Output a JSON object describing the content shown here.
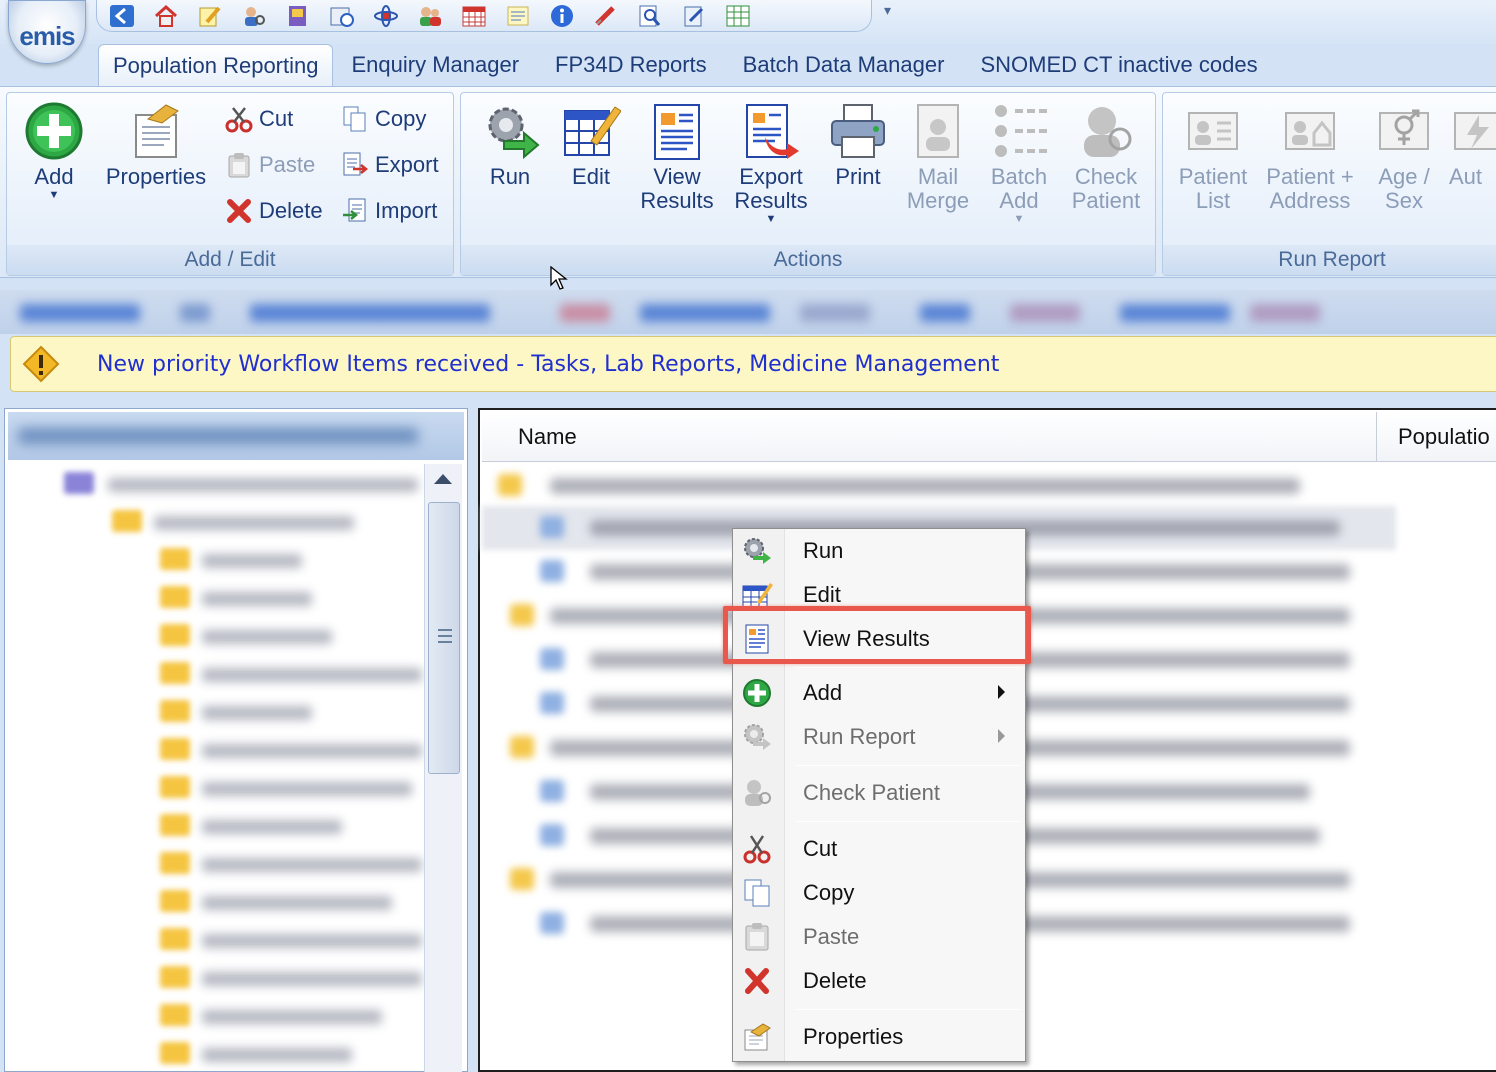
{
  "app": {
    "logo_text": "emis"
  },
  "tabs": [
    {
      "label": "Population Reporting",
      "active": true
    },
    {
      "label": "Enquiry Manager",
      "active": false
    },
    {
      "label": "FP34D Reports",
      "active": false
    },
    {
      "label": "Batch Data Manager",
      "active": false
    },
    {
      "label": "SNOMED CT inactive codes",
      "active": false
    }
  ],
  "ribbon": {
    "add_edit": {
      "label": "Add / Edit",
      "add": "Add",
      "properties": "Properties",
      "cut": "Cut",
      "paste": "Paste",
      "delete": "Delete",
      "copy": "Copy",
      "export": "Export",
      "import": "Import"
    },
    "actions": {
      "label": "Actions",
      "run": "Run",
      "edit": "Edit",
      "view_results": "View\nResults",
      "export_results": "Export\nResults",
      "print": "Print",
      "mail_merge": "Mail\nMerge",
      "batch_add": "Batch\nAdd",
      "check_patient": "Check\nPatient"
    },
    "run_report": {
      "label": "Run Report",
      "patient_list": "Patient\nList",
      "patient_address": "Patient +\nAddress",
      "age_sex": "Age /\nSex",
      "auto": "Aut"
    }
  },
  "notification": {
    "message": "New priority Workflow Items received - Tasks, Lab Reports, Medicine Management"
  },
  "list": {
    "columns": [
      "Name",
      "Populatio"
    ]
  },
  "context_menu": {
    "items": [
      {
        "label": "Run",
        "icon": "run-gear-icon",
        "enabled": true
      },
      {
        "label": "Edit",
        "icon": "edit-grid-icon",
        "enabled": true
      },
      {
        "label": "View Results",
        "icon": "view-results-icon",
        "enabled": true,
        "highlighted": true
      },
      {
        "label": "Add",
        "icon": "add-plus-icon",
        "enabled": true,
        "submenu": true
      },
      {
        "label": "Run Report",
        "icon": "run-report-icon",
        "enabled": false,
        "submenu": true
      },
      {
        "label": "Check Patient",
        "icon": "check-patient-icon",
        "enabled": false
      },
      {
        "label": "Cut",
        "icon": "scissors-icon",
        "enabled": true
      },
      {
        "label": "Copy",
        "icon": "copy-icon",
        "enabled": true
      },
      {
        "label": "Paste",
        "icon": "paste-icon",
        "enabled": false
      },
      {
        "label": "Delete",
        "icon": "delete-x-icon",
        "enabled": true
      },
      {
        "label": "Properties",
        "icon": "properties-icon",
        "enabled": true
      }
    ]
  },
  "colors": {
    "highlight_border": "#e8584c",
    "notification_bg": "#fdf7c6",
    "notification_text": "#1f2fd0",
    "ribbon_text": "#1e3c78"
  }
}
